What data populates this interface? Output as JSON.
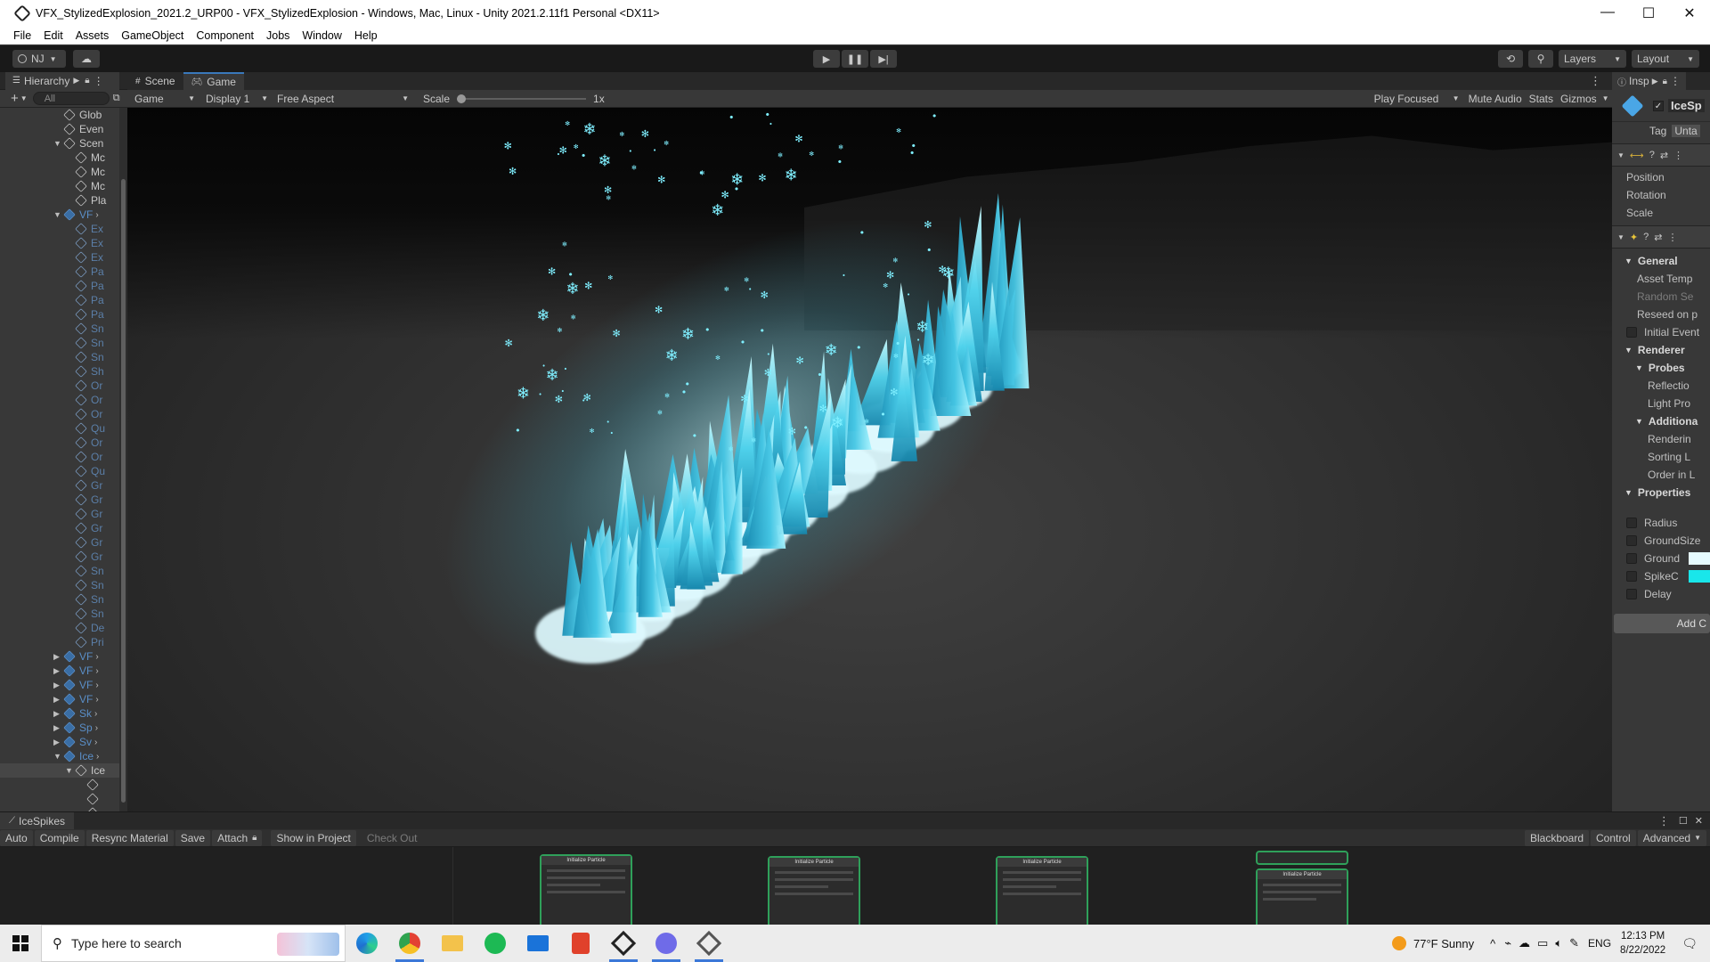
{
  "window": {
    "title": "VFX_StylizedExplosion_2021.2_URP00 - VFX_StylizedExplosion - Windows, Mac, Linux - Unity 2021.2.11f1 Personal <DX11>",
    "minimize": "—",
    "maximize": "☐",
    "close": "✕"
  },
  "menu": [
    "File",
    "Edit",
    "Assets",
    "GameObject",
    "Component",
    "Jobs",
    "Window",
    "Help"
  ],
  "toolbar": {
    "account": "NJ",
    "layers": "Layers",
    "layout": "Layout"
  },
  "hierarchy": {
    "tab": "Hierarchy",
    "search_placeholder": "All",
    "rows": [
      {
        "text": "Glob",
        "indent": 4,
        "style": "normal",
        "arrow": ""
      },
      {
        "text": "Even",
        "indent": 4,
        "style": "normal",
        "arrow": ""
      },
      {
        "text": "Scen",
        "indent": 4,
        "style": "normal",
        "arrow": "▼"
      },
      {
        "text": "Mc",
        "indent": 5,
        "style": "normal",
        "arrow": ""
      },
      {
        "text": "Mc",
        "indent": 5,
        "style": "normal",
        "arrow": ""
      },
      {
        "text": "Mc",
        "indent": 5,
        "style": "normal",
        "arrow": ""
      },
      {
        "text": "Pla",
        "indent": 5,
        "style": "normal",
        "arrow": ""
      },
      {
        "text": "VF",
        "indent": 4,
        "style": "blue",
        "arrow": "▼",
        "chev": true
      },
      {
        "text": "Ex",
        "indent": 5,
        "style": "dim",
        "arrow": ""
      },
      {
        "text": "Ex",
        "indent": 5,
        "style": "dim",
        "arrow": ""
      },
      {
        "text": "Ex",
        "indent": 5,
        "style": "dim",
        "arrow": ""
      },
      {
        "text": "Pa",
        "indent": 5,
        "style": "dim",
        "arrow": ""
      },
      {
        "text": "Pa",
        "indent": 5,
        "style": "dim",
        "arrow": ""
      },
      {
        "text": "Pa",
        "indent": 5,
        "style": "dim",
        "arrow": ""
      },
      {
        "text": "Pa",
        "indent": 5,
        "style": "dim",
        "arrow": ""
      },
      {
        "text": "Sn",
        "indent": 5,
        "style": "dim",
        "arrow": ""
      },
      {
        "text": "Sn",
        "indent": 5,
        "style": "dim",
        "arrow": ""
      },
      {
        "text": "Sn",
        "indent": 5,
        "style": "dim",
        "arrow": ""
      },
      {
        "text": "Sh",
        "indent": 5,
        "style": "dim",
        "arrow": ""
      },
      {
        "text": "Or",
        "indent": 5,
        "style": "dim",
        "arrow": ""
      },
      {
        "text": "Or",
        "indent": 5,
        "style": "dim",
        "arrow": ""
      },
      {
        "text": "Or",
        "indent": 5,
        "style": "dim",
        "arrow": ""
      },
      {
        "text": "Qu",
        "indent": 5,
        "style": "dim",
        "arrow": ""
      },
      {
        "text": "Or",
        "indent": 5,
        "style": "dim",
        "arrow": ""
      },
      {
        "text": "Or",
        "indent": 5,
        "style": "dim",
        "arrow": ""
      },
      {
        "text": "Qu",
        "indent": 5,
        "style": "dim",
        "arrow": ""
      },
      {
        "text": "Gr",
        "indent": 5,
        "style": "dim",
        "arrow": ""
      },
      {
        "text": "Gr",
        "indent": 5,
        "style": "dim",
        "arrow": ""
      },
      {
        "text": "Gr",
        "indent": 5,
        "style": "dim",
        "arrow": ""
      },
      {
        "text": "Gr",
        "indent": 5,
        "style": "dim",
        "arrow": ""
      },
      {
        "text": "Gr",
        "indent": 5,
        "style": "dim",
        "arrow": ""
      },
      {
        "text": "Gr",
        "indent": 5,
        "style": "dim",
        "arrow": ""
      },
      {
        "text": "Sn",
        "indent": 5,
        "style": "dim",
        "arrow": ""
      },
      {
        "text": "Sn",
        "indent": 5,
        "style": "dim",
        "arrow": ""
      },
      {
        "text": "Sn",
        "indent": 5,
        "style": "dim",
        "arrow": ""
      },
      {
        "text": "Sn",
        "indent": 5,
        "style": "dim",
        "arrow": ""
      },
      {
        "text": "De",
        "indent": 5,
        "style": "dim",
        "arrow": ""
      },
      {
        "text": "Pri",
        "indent": 5,
        "style": "dim",
        "arrow": ""
      },
      {
        "text": "VF",
        "indent": 4,
        "style": "blue",
        "arrow": "▶",
        "chev": true
      },
      {
        "text": "VF",
        "indent": 4,
        "style": "blue",
        "arrow": "▶",
        "chev": true
      },
      {
        "text": "VF",
        "indent": 4,
        "style": "blue",
        "arrow": "▶",
        "chev": true
      },
      {
        "text": "VF",
        "indent": 4,
        "style": "blue",
        "arrow": "▶",
        "chev": true
      },
      {
        "text": "Sk",
        "indent": 4,
        "style": "blue",
        "arrow": "▶",
        "chev": true
      },
      {
        "text": "Sp",
        "indent": 4,
        "style": "blue",
        "arrow": "▶",
        "chev": true
      },
      {
        "text": "Sv",
        "indent": 4,
        "style": "blue",
        "arrow": "▶",
        "chev": true
      },
      {
        "text": "Ice",
        "indent": 4,
        "style": "blue",
        "arrow": "▼",
        "chev": true
      },
      {
        "text": "Ice",
        "indent": 5,
        "style": "sel",
        "arrow": "▼"
      },
      {
        "text": "",
        "indent": 6,
        "style": "normal",
        "arrow": ""
      },
      {
        "text": "",
        "indent": 6,
        "style": "normal",
        "arrow": ""
      },
      {
        "text": "",
        "indent": 6,
        "style": "normal",
        "arrow": ""
      }
    ]
  },
  "scene_tabs": {
    "scene": "Scene",
    "game": "Game"
  },
  "game_toolbar": {
    "mode": "Game",
    "display": "Display 1",
    "aspect": "Free Aspect",
    "scale_label": "Scale",
    "scale_value": "1x",
    "scale_fraction": 0.0,
    "play_focused": "Play Focused",
    "mute_audio": "Mute Audio",
    "stats": "Stats",
    "gizmos": "Gizmos"
  },
  "inspector": {
    "tab": "Insp",
    "object_name": "IceSp",
    "tag_label": "Tag",
    "tag_value": "Unta",
    "transform": [
      "Position",
      "Rotation",
      "Scale"
    ],
    "general_header": "General",
    "general_items": [
      "Asset Temp",
      "Random Se",
      "Reseed on p",
      "Initial Event"
    ],
    "renderer_header": "Renderer",
    "probes_header": "Probes",
    "probe_items": [
      "Reflectio",
      "Light Pro"
    ],
    "additional_header": "Additiona",
    "additional_items": [
      "Renderin",
      "Sorting L",
      "Order in L"
    ],
    "properties_header": "Properties",
    "properties": [
      {
        "name": "Radius"
      },
      {
        "name": "GroundSize"
      },
      {
        "name": "Ground",
        "color": "#e6fbff"
      },
      {
        "name": "SpikeC",
        "color": "#19e6ea"
      },
      {
        "name": "Delay"
      }
    ],
    "add_component": "Add C"
  },
  "vfx_graph": {
    "tab": "IceSpikes",
    "buttons": [
      "Auto",
      "Compile",
      "Resync Material",
      "Save",
      "Attach"
    ],
    "show_in_project": "Show in Project",
    "check_out": "Check Out",
    "right_buttons": [
      "Blackboard",
      "Control",
      "Advanced"
    ],
    "node_titles": [
      "Initialize Particle",
      "Initialize Particle",
      "Initialize Particle",
      "Initialize Particle"
    ]
  },
  "taskbar": {
    "search_placeholder": "Type here to search",
    "weather": "77°F  Sunny",
    "language": "ENG",
    "time": "12:13 PM",
    "date": "8/22/2022"
  },
  "colors": {
    "ice_core": "#8ff3ff",
    "ice_mid": "#33c6e6",
    "ice_dark": "#137a9c",
    "accent_tab": "#3a79bb",
    "node_border": "#2fa05a"
  }
}
